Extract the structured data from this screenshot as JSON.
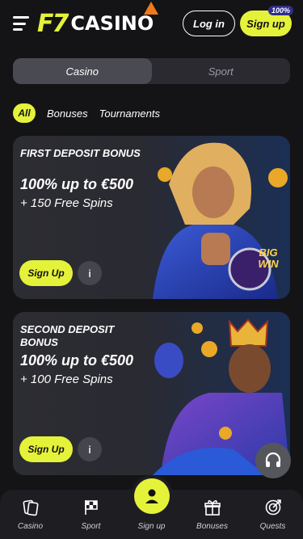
{
  "header": {
    "logo_mark": "F7",
    "logo_word": "CASINO",
    "login_label": "Log in",
    "signup_label": "Sign up",
    "signup_badge": "100%"
  },
  "segmented": {
    "items": [
      {
        "label": "Casino",
        "active": true
      },
      {
        "label": "Sport",
        "active": false
      }
    ]
  },
  "filters": {
    "all_label": "All",
    "items": [
      "Bonuses",
      "Tournaments"
    ]
  },
  "promos": [
    {
      "title": "First Deposit Bonus",
      "amount": "100% up to €500",
      "spins": "+ 150 Free Spins",
      "button": "Sign Up",
      "info_icon": "info-icon"
    },
    {
      "title": "Second Deposit Bonus",
      "amount": "100% up to €500",
      "spins": "+ 100 Free Spins",
      "button": "Sign Up",
      "info_icon": "info-icon"
    }
  ],
  "promo_art_badge": "BIG WIN",
  "bottom_nav": [
    {
      "label": "Casino",
      "icon": "cards-icon"
    },
    {
      "label": "Sport",
      "icon": "flag-icon"
    },
    {
      "label": "Sign up",
      "icon": "user-icon"
    },
    {
      "label": "Bonuses",
      "icon": "gift-icon"
    },
    {
      "label": "Quests",
      "icon": "target-icon"
    }
  ],
  "colors": {
    "accent": "#e5f23a",
    "background": "#141417",
    "card": "#2c2c33"
  }
}
